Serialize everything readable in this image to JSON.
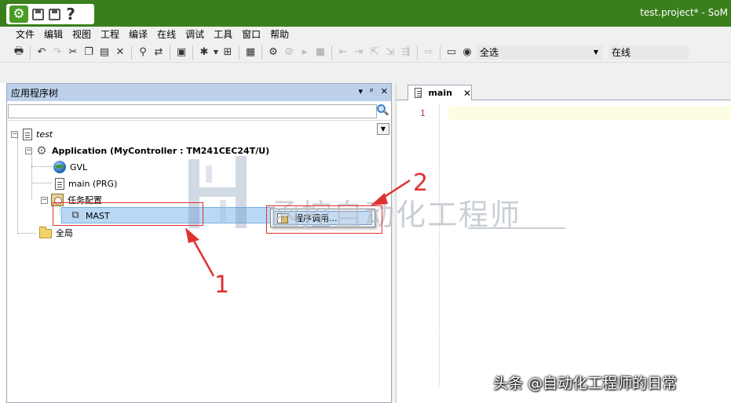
{
  "window": {
    "title": "test.project* - SoM",
    "quick_access": {
      "logo_icon": "gear-logo-icon",
      "help_label": "?"
    }
  },
  "menu": [
    "文件",
    "编辑",
    "视图",
    "工程",
    "编译",
    "在线",
    "调试",
    "工具",
    "窗口",
    "帮助"
  ],
  "toolbar": {
    "icons": [
      "print-icon",
      "undo-icon",
      "redo-icon",
      "cut-icon",
      "copy-icon",
      "paste-icon",
      "delete-icon",
      "find-icon",
      "replace-icon",
      "select-all-icon",
      "new-item-icon",
      "add-object-icon",
      "build-icon",
      "login-icon",
      "logout-icon",
      "run-icon",
      "stop-icon",
      "step-icons",
      "online-icon"
    ],
    "select_value": "全选",
    "mode_value": "在线"
  },
  "tree_panel": {
    "title": "应用程序树",
    "controls": [
      "▾",
      "ᵖ",
      "✕"
    ],
    "search_placeholder": "",
    "nodes": {
      "project": "test",
      "application": "Application (MyController : TM241CEC24T/U)",
      "gvl": "GVL",
      "main": "main (PRG)",
      "task_config": "任务配置",
      "mast": "MAST",
      "global": "全局"
    }
  },
  "context_menu": {
    "item": "程序调用..."
  },
  "editor": {
    "tab_label": "main",
    "line_number": "1"
  },
  "annotations": {
    "box1_number": "1",
    "box2_number": "2",
    "color": "#e03030"
  },
  "watermark": {
    "text": "函控自动化工程师"
  },
  "credit": "头条 @自动化工程师的日常",
  "colors": {
    "title_bar": "#3a7f1c",
    "panel_header": "#bcd0ea",
    "selection": "#b8d8f5"
  }
}
